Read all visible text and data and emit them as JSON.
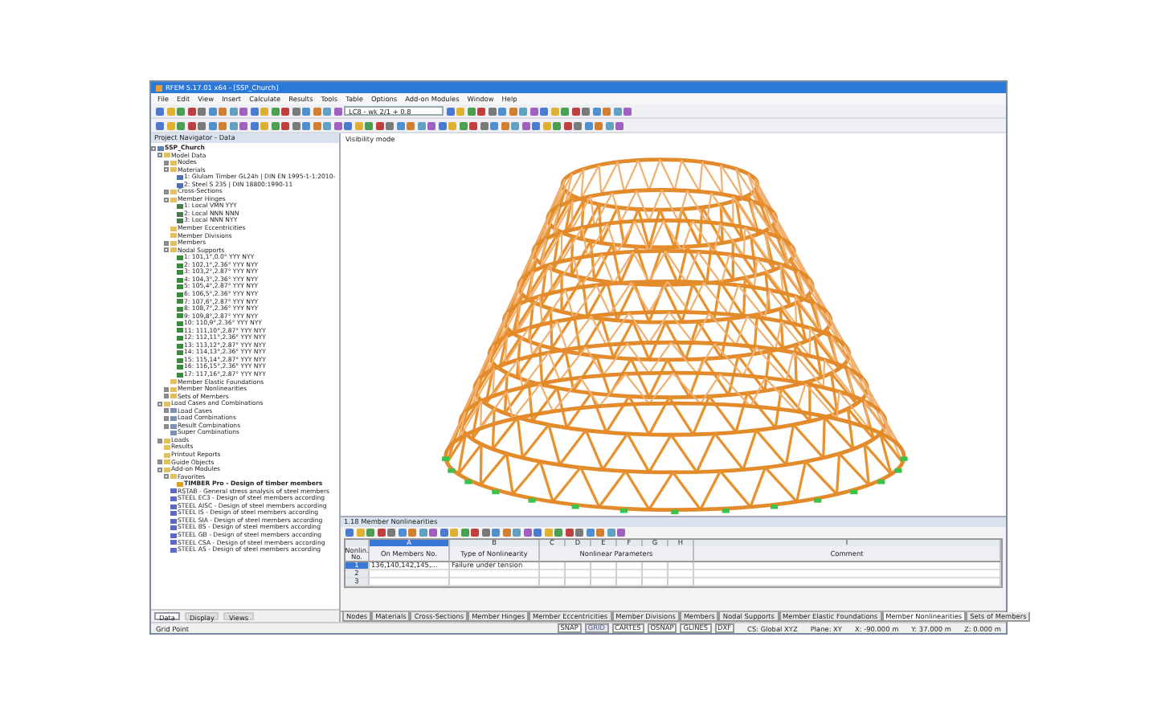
{
  "window": {
    "title": "RFEM 5.17.01 x64 - [SSP_Church]"
  },
  "menu": [
    "File",
    "Edit",
    "View",
    "Insert",
    "Calculate",
    "Results",
    "Tools",
    "Table",
    "Options",
    "Add-on Modules",
    "Window",
    "Help"
  ],
  "toolbar": {
    "load_case": "LC8 - wk 2/1 + 0.8"
  },
  "navigator": {
    "title": "Project Navigator - Data",
    "tree": [
      {
        "label": "SSP_Church",
        "kind": "project",
        "expanded": true,
        "children": [
          {
            "label": "Model Data",
            "kind": "folder",
            "expanded": true,
            "children": [
              {
                "label": "Nodes",
                "kind": "folder",
                "expanded": false
              },
              {
                "label": "Materials",
                "kind": "folder",
                "expanded": true,
                "children": [
                  {
                    "label": "1: Glulam Timber GL24h | DIN EN 1995-1-1:2010-",
                    "kind": "material"
                  },
                  {
                    "label": "2: Steel S 235 | DIN 18800:1990-11",
                    "kind": "material"
                  }
                ]
              },
              {
                "label": "Cross-Sections",
                "kind": "folder",
                "expanded": false
              },
              {
                "label": "Member Hinges",
                "kind": "folder",
                "expanded": true,
                "children": [
                  {
                    "label": "1: Local VMN YYY",
                    "kind": "hinge"
                  },
                  {
                    "label": "2: Local NNN NNN",
                    "kind": "hinge"
                  },
                  {
                    "label": "3: Local NNN NYY",
                    "kind": "hinge"
                  }
                ]
              },
              {
                "label": "Member Eccentricities",
                "kind": "folder"
              },
              {
                "label": "Member Divisions",
                "kind": "folder"
              },
              {
                "label": "Members",
                "kind": "folder",
                "expanded": false
              },
              {
                "label": "Nodal Supports",
                "kind": "folder",
                "expanded": true,
                "children": [
                  {
                    "label": "1: 101,1°,0.0° YYY NYY",
                    "kind": "support"
                  },
                  {
                    "label": "2: 102,1°,2.36° YYY NYY",
                    "kind": "support"
                  },
                  {
                    "label": "3: 103,2°,2.87° YYY NYY",
                    "kind": "support"
                  },
                  {
                    "label": "4: 104,3°,2.36° YYY NYY",
                    "kind": "support"
                  },
                  {
                    "label": "5: 105,4°,2.87° YYY NYY",
                    "kind": "support"
                  },
                  {
                    "label": "6: 106,5°,2.36° YYY NYY",
                    "kind": "support"
                  },
                  {
                    "label": "7: 107,6°,2.87° YYY NYY",
                    "kind": "support"
                  },
                  {
                    "label": "8: 108,7°,2.36° YYY NYY",
                    "kind": "support"
                  },
                  {
                    "label": "9: 109,8°,2.87° YYY NYY",
                    "kind": "support"
                  },
                  {
                    "label": "10: 110,9°,2.36° YYY NYY",
                    "kind": "support"
                  },
                  {
                    "label": "11: 111,10°,2.87° YYY NYY",
                    "kind": "support"
                  },
                  {
                    "label": "12: 112,11°,2.36° YYY NYY",
                    "kind": "support"
                  },
                  {
                    "label": "13: 113,12°,2.87° YYY NYY",
                    "kind": "support"
                  },
                  {
                    "label": "14: 114,13°,2.36° YYY NYY",
                    "kind": "support"
                  },
                  {
                    "label": "15: 115,14°,2.87° YYY NYY",
                    "kind": "support"
                  },
                  {
                    "label": "16: 116,15°,2.36° YYY NYY",
                    "kind": "support"
                  },
                  {
                    "label": "17: 117,16°,2.87° YYY NYY",
                    "kind": "support"
                  }
                ]
              },
              {
                "label": "Member Elastic Foundations",
                "kind": "folder"
              },
              {
                "label": "Member Nonlinearities",
                "kind": "folder",
                "expanded": false
              },
              {
                "label": "Sets of Members",
                "kind": "folder",
                "expanded": false
              }
            ]
          },
          {
            "label": "Load Cases and Combinations",
            "kind": "folder",
            "expanded": true,
            "children": [
              {
                "label": "Load Cases",
                "kind": "loads",
                "expanded": false
              },
              {
                "label": "Load Combinations",
                "kind": "loads",
                "expanded": false
              },
              {
                "label": "Result Combinations",
                "kind": "loads",
                "expanded": false
              },
              {
                "label": "Super Combinations",
                "kind": "loads"
              }
            ]
          },
          {
            "label": "Loads",
            "kind": "folder",
            "expanded": false
          },
          {
            "label": "Results",
            "kind": "folder"
          },
          {
            "label": "Printout Reports",
            "kind": "folder"
          },
          {
            "label": "Guide Objects",
            "kind": "folder",
            "expanded": false
          },
          {
            "label": "Add-on Modules",
            "kind": "folder",
            "expanded": true,
            "children": [
              {
                "label": "Favorites",
                "kind": "folder",
                "expanded": true,
                "children": [
                  {
                    "label": "TIMBER Pro - Design of timber members",
                    "kind": "favorite"
                  }
                ]
              },
              {
                "label": "RSTAB - General stress analysis of steel members",
                "kind": "module"
              },
              {
                "label": "STEEL EC3 - Design of steel members according",
                "kind": "module"
              },
              {
                "label": "STEEL AISC - Design of steel members according",
                "kind": "module"
              },
              {
                "label": "STEEL IS - Design of steel members according",
                "kind": "module"
              },
              {
                "label": "STEEL SIA - Design of steel members according",
                "kind": "module"
              },
              {
                "label": "STEEL BS - Design of steel members according",
                "kind": "module"
              },
              {
                "label": "STEEL GB - Design of steel members according",
                "kind": "module"
              },
              {
                "label": "STEEL CSA - Design of steel members according",
                "kind": "module"
              },
              {
                "label": "STEEL AS - Design of steel members according",
                "kind": "module"
              }
            ]
          }
        ]
      }
    ],
    "tabs": [
      {
        "label": "Data",
        "selected": true
      },
      {
        "label": "Display",
        "selected": false
      },
      {
        "label": "Views",
        "selected": false
      }
    ]
  },
  "viewport": {
    "label": "Visibility mode"
  },
  "table": {
    "title": "1.18 Member Nonlinearities",
    "column_letters": [
      "A",
      "B",
      "C",
      "D",
      "E",
      "F",
      "G",
      "H",
      "I"
    ],
    "headers": [
      "Nonlin. No.",
      "On Members No.",
      "Type of Nonlinearity",
      "Nonlinear Parameters",
      "Comment"
    ],
    "rows": [
      {
        "no": "1",
        "members": "136,140,142,145,...",
        "type": "Failure under tension",
        "selected": true
      },
      {
        "no": "2",
        "members": "",
        "type": "",
        "selected": false
      },
      {
        "no": "3",
        "members": "",
        "type": "",
        "selected": false
      }
    ],
    "tabs": [
      {
        "label": "Nodes",
        "selected": false
      },
      {
        "label": "Materials",
        "selected": false
      },
      {
        "label": "Cross-Sections",
        "selected": false
      },
      {
        "label": "Member Hinges",
        "selected": false
      },
      {
        "label": "Member Eccentricities",
        "selected": false
      },
      {
        "label": "Member Divisions",
        "selected": false
      },
      {
        "label": "Members",
        "selected": false
      },
      {
        "label": "Nodal Supports",
        "selected": false
      },
      {
        "label": "Member Elastic Foundations",
        "selected": false
      },
      {
        "label": "Member Nonlinearities",
        "selected": true
      },
      {
        "label": "Sets of Members",
        "selected": false
      }
    ]
  },
  "status_bar": {
    "hint": "Grid Point",
    "toggles": [
      {
        "label": "SNAP",
        "on": true
      },
      {
        "label": "GRID",
        "on": false
      },
      {
        "label": "CARTES",
        "on": true
      },
      {
        "label": "OSNAP",
        "on": true
      },
      {
        "label": "GLINES",
        "on": true
      },
      {
        "label": "DXF",
        "on": true
      }
    ],
    "fields": [
      "CS: Global XYZ",
      "Plane: XY",
      "X: -90.000 m",
      "Y: 37.000 m",
      "Z: 0.000 m"
    ]
  }
}
